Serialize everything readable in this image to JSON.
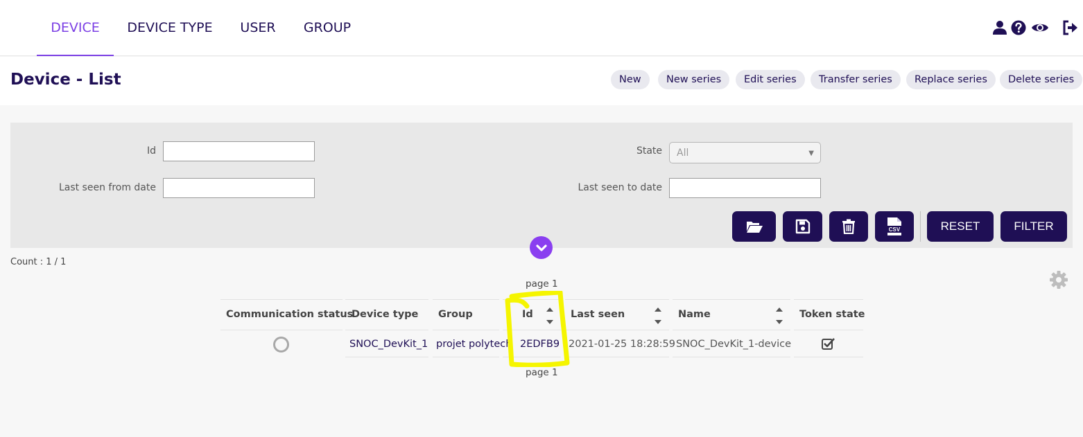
{
  "nav": {
    "tabs": [
      {
        "label": "DEVICE",
        "active": true
      },
      {
        "label": "DEVICE TYPE",
        "active": false
      },
      {
        "label": "USER",
        "active": false
      },
      {
        "label": "GROUP",
        "active": false
      }
    ],
    "icons": [
      "user-icon",
      "help-icon",
      "eye-icon",
      "logout-icon"
    ]
  },
  "header": {
    "title": "Device - List",
    "buttons": [
      "New",
      "New series",
      "Edit series",
      "Transfer series",
      "Replace series",
      "Delete series"
    ]
  },
  "filter": {
    "id_label": "Id",
    "id_value": "",
    "state_label": "State",
    "state_value": "All",
    "from_label": "Last seen from date",
    "from_value": "",
    "to_label": "Last seen to date",
    "to_value": "",
    "icon_buttons": [
      "folder-open-icon",
      "save-icon",
      "trash-icon",
      "csv-icon"
    ],
    "reset_label": "RESET",
    "filter_label": "FILTER",
    "toggle_icon": "chevron-down-icon"
  },
  "results": {
    "count": "Count : 1 / 1",
    "page_top": "page 1",
    "page_bottom": "page 1",
    "settings_icon": "gear-icon"
  },
  "table": {
    "columns": [
      "Communication status",
      "Device type",
      "Group",
      "Id",
      "Last seen",
      "Name",
      "Token state"
    ],
    "rows": [
      {
        "communication_status": "status-ring-icon",
        "device_type": "SNOC_DevKit_1",
        "group": "projet polytech",
        "id": "2EDFB9",
        "last_seen": "2021-01-25 18:28:59",
        "name": "SNOC_DevKit_1-device",
        "token_state": "checkbox-checked-icon"
      }
    ]
  },
  "colors": {
    "primary": "#1f0f55",
    "accent": "#7b3fe4",
    "toggle": "#8a3ff0",
    "annotation": "#f5f500"
  }
}
